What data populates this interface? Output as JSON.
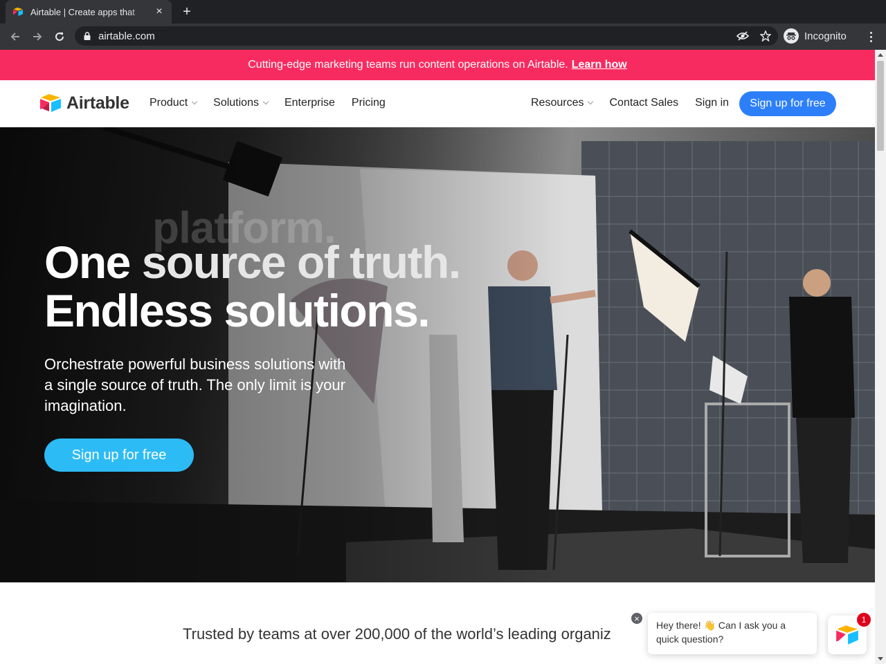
{
  "browser": {
    "tab_title": "Airtable | Create apps that",
    "tab_close": "×",
    "new_tab": "+",
    "url": "airtable.com",
    "incognito_label": "Incognito"
  },
  "promo": {
    "text": "Cutting-edge marketing teams run content operations on Airtable.",
    "link": "Learn how",
    "color": "#f82b60"
  },
  "nav": {
    "brand": "Airtable",
    "left_items": [
      {
        "label": "Product",
        "has_dropdown": true
      },
      {
        "label": "Solutions",
        "has_dropdown": true
      },
      {
        "label": "Enterprise",
        "has_dropdown": false
      },
      {
        "label": "Pricing",
        "has_dropdown": false
      }
    ],
    "right_items": [
      {
        "label": "Resources",
        "has_dropdown": true
      },
      {
        "label": "Contact Sales",
        "has_dropdown": false
      },
      {
        "label": "Sign in",
        "has_dropdown": false
      }
    ],
    "signup_label": "Sign up for free",
    "signup_color": "#2d7ff9"
  },
  "hero": {
    "rotator_ghost": "platform.",
    "headline_one": "One",
    "headline_rotator": "source of truth.",
    "headline_two": "Endless solutions.",
    "subtitle": "Orchestrate powerful business solutions with a single source of truth. The only limit is your imagination.",
    "cta_label": "Sign up for free",
    "cta_color": "#2dbbf5"
  },
  "trusted": {
    "text": "Trusted by teams at over 200,000 of the world’s leading organiz"
  },
  "chat": {
    "close": "×",
    "message": "Hey there! 👋 Can I ask you a quick question?",
    "badge_count": "1"
  },
  "icons": {
    "back": "arrow-left-icon",
    "forward": "arrow-right-icon",
    "reload": "reload-icon",
    "lock": "lock-icon",
    "eye_off": "eye-off-icon",
    "star": "star-icon",
    "incognito": "incognito-icon",
    "menu": "kebab-menu-icon"
  }
}
